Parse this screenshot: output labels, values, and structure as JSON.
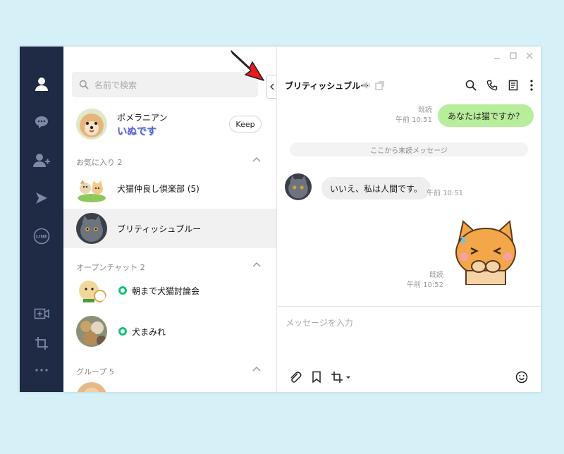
{
  "list": {
    "search_placeholder": "名前で検索",
    "profile": {
      "name": "ポメラニアン",
      "status": "いぬです",
      "keep_label": "Keep"
    },
    "sections": {
      "favorites": "お気に入り 2",
      "openchat": "オープンチャット 2",
      "groups": "グループ 5"
    },
    "favorites": [
      {
        "name": "犬猫仲良し倶楽部 (5)"
      },
      {
        "name": "ブリティッシュブルー"
      }
    ],
    "openchats": [
      {
        "name": "朝まで犬猫討論会"
      },
      {
        "name": "犬まみれ"
      }
    ]
  },
  "chat": {
    "title": "ブリティッシュブルー",
    "messages": {
      "out1": {
        "text": "あなたは猫ですか？",
        "read": "既読",
        "time": "午前 10:51"
      },
      "unread_divider": "ここから未読メッセージ",
      "in1": {
        "text": "いいえ、私は人間です。",
        "time": "午前 10:51"
      },
      "sticker": {
        "read": "既読",
        "time": "午前 10:52"
      }
    },
    "input_placeholder": "メッセージを入力"
  },
  "colors": {
    "rail": "#1f2a45",
    "my_bubble": "#b8ed9c",
    "their_bubble": "#eeeeee",
    "open_badge": "#14c27a",
    "arrow": "#e81b1b"
  }
}
